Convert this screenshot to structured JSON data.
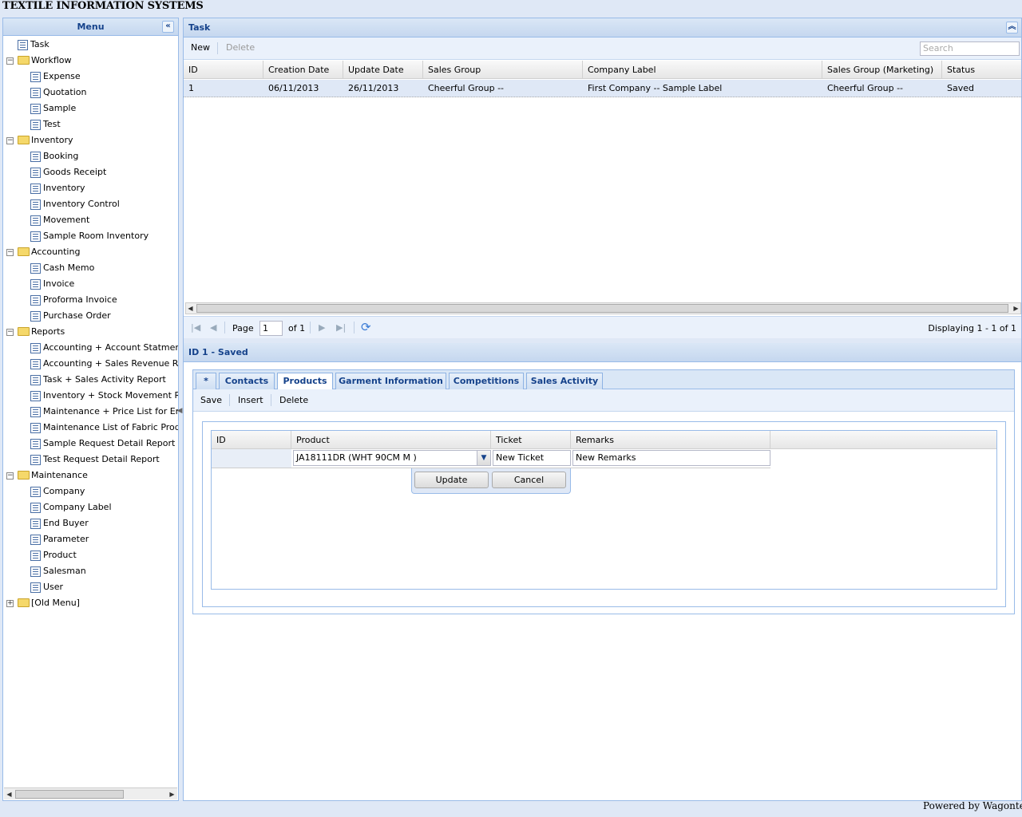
{
  "app_title": "TEXTILE INFORMATION SYSTEMS",
  "footer": "Powered by Wagontec",
  "menu": {
    "title": "Menu",
    "collapse_icon": "double-chevron-left-icon",
    "tree": [
      {
        "label": "Task",
        "type": "leaf",
        "level": 0
      },
      {
        "label": "Workflow",
        "type": "folder"
      },
      {
        "label": "Expense",
        "type": "leaf",
        "level": 1
      },
      {
        "label": "Quotation",
        "type": "leaf",
        "level": 1
      },
      {
        "label": "Sample",
        "type": "leaf",
        "level": 1
      },
      {
        "label": "Test",
        "type": "leaf",
        "level": 1
      },
      {
        "label": "Inventory",
        "type": "folder"
      },
      {
        "label": "Booking",
        "type": "leaf",
        "level": 1
      },
      {
        "label": "Goods Receipt",
        "type": "leaf",
        "level": 1
      },
      {
        "label": "Inventory",
        "type": "leaf",
        "level": 1
      },
      {
        "label": "Inventory Control",
        "type": "leaf",
        "level": 1
      },
      {
        "label": "Movement",
        "type": "leaf",
        "level": 1
      },
      {
        "label": "Sample Room Inventory",
        "type": "leaf",
        "level": 1
      },
      {
        "label": "Accounting",
        "type": "folder"
      },
      {
        "label": "Cash Memo",
        "type": "leaf",
        "level": 1
      },
      {
        "label": "Invoice",
        "type": "leaf",
        "level": 1
      },
      {
        "label": "Proforma Invoice",
        "type": "leaf",
        "level": 1
      },
      {
        "label": "Purchase Order",
        "type": "leaf",
        "level": 1
      },
      {
        "label": "Reports",
        "type": "folder"
      },
      {
        "label": "Accounting + Account Statment",
        "type": "leaf",
        "level": 1
      },
      {
        "label": "Accounting + Sales Revenue Report",
        "type": "leaf",
        "level": 1
      },
      {
        "label": "Task + Sales Activity Report",
        "type": "leaf",
        "level": 1
      },
      {
        "label": "Inventory + Stock Movement Report",
        "type": "leaf",
        "level": 1
      },
      {
        "label": "Maintenance + Price List for End Buyer",
        "type": "leaf",
        "level": 1
      },
      {
        "label": "Maintenance List of Fabric Products",
        "type": "leaf",
        "level": 1
      },
      {
        "label": "Sample Request Detail Report",
        "type": "leaf",
        "level": 1
      },
      {
        "label": "Test Request Detail Report",
        "type": "leaf",
        "level": 1
      },
      {
        "label": "Maintenance",
        "type": "folder"
      },
      {
        "label": "Company",
        "type": "leaf",
        "level": 1
      },
      {
        "label": "Company Label",
        "type": "leaf",
        "level": 1
      },
      {
        "label": "End Buyer",
        "type": "leaf",
        "level": 1
      },
      {
        "label": "Parameter",
        "type": "leaf",
        "level": 1
      },
      {
        "label": "Product",
        "type": "leaf",
        "level": 1
      },
      {
        "label": "Salesman",
        "type": "leaf",
        "level": 1
      },
      {
        "label": "User",
        "type": "leaf",
        "level": 1
      },
      {
        "label": "[Old Menu]",
        "type": "folder-collapsed"
      }
    ]
  },
  "task_panel": {
    "title": "Task",
    "collapse_icon": "double-chevron-up-icon",
    "toolbar": {
      "new": "New",
      "delete": "Delete"
    },
    "search_placeholder": "Search",
    "columns": [
      "ID",
      "Creation Date",
      "Update Date",
      "Sales Group",
      "Company Label",
      "Sales Group (Marketing)",
      "Status"
    ],
    "rows": [
      [
        "1",
        "06/11/2013",
        "26/11/2013",
        "Cheerful Group --",
        "First Company -- Sample Label",
        "Cheerful Group --",
        "Saved"
      ]
    ],
    "pager": {
      "page_label": "Page",
      "page_value": "1",
      "of_label": "of 1",
      "displaying": "Displaying 1 - 1 of 1"
    }
  },
  "detail": {
    "title": "ID 1 - Saved",
    "tabs": [
      "*",
      "Contacts",
      "Products",
      "Garment Information",
      "Competitions",
      "Sales Activity"
    ],
    "active_tab": "Products",
    "toolbar": {
      "save": "Save",
      "insert": "Insert",
      "delete": "Delete"
    },
    "grid": {
      "columns": [
        "ID",
        "Product",
        "Ticket",
        "Remarks"
      ],
      "editor": {
        "id": "",
        "product": "JA18111DR (WHT 90CM  M  )",
        "ticket": "New Ticket",
        "remarks": "New Remarks"
      },
      "update": "Update",
      "cancel": "Cancel"
    }
  },
  "colors": {
    "accent": "#15428b",
    "panel_bg": "#dfe8f6",
    "border": "#99bbe8"
  }
}
